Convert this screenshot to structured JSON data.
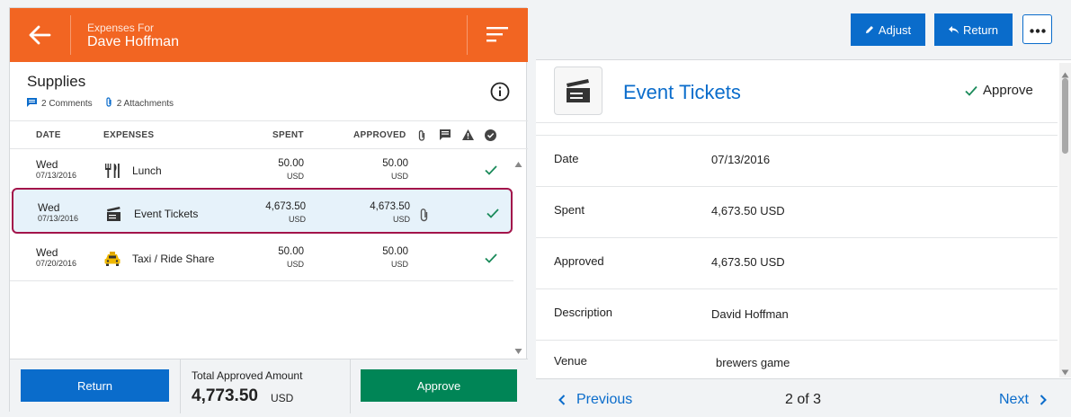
{
  "header": {
    "subtitle": "Expenses For",
    "employee": "Dave Hoffman"
  },
  "report": {
    "title": "Supplies",
    "comments": "2 Comments",
    "attachments": "2 Attachments"
  },
  "table": {
    "columns": {
      "date": "DATE",
      "expenses": "EXPENSES",
      "spent": "SPENT",
      "approved": "APPROVED"
    },
    "rows": [
      {
        "day": "Wed",
        "date": "07/13/2016",
        "icon": "fork-knife-icon",
        "label": "Lunch",
        "spent": "50.00",
        "spent_cur": "USD",
        "approved": "50.00",
        "approved_cur": "USD",
        "attachment": false
      },
      {
        "day": "Wed",
        "date": "07/13/2016",
        "icon": "clapperboard-icon",
        "label": "Event Tickets",
        "spent": "4,673.50",
        "spent_cur": "USD",
        "approved": "4,673.50",
        "approved_cur": "USD",
        "attachment": true,
        "selected": true
      },
      {
        "day": "Wed",
        "date": "07/20/2016",
        "icon": "taxi-icon",
        "label": "Taxi / Ride Share",
        "spent": "50.00",
        "spent_cur": "USD",
        "approved": "50.00",
        "approved_cur": "USD",
        "attachment": false
      }
    ]
  },
  "footer": {
    "return_label": "Return",
    "total_label": "Total Approved Amount",
    "total_value": "4,773.50",
    "total_currency": "USD",
    "approve_label": "Approve"
  },
  "toolbar": {
    "adjust_label": "Adjust",
    "return_label": "Return"
  },
  "detail": {
    "title": "Event Tickets",
    "approve_label": "Approve",
    "fields": [
      {
        "key": "Date",
        "value": "07/13/2016"
      },
      {
        "key": "Spent",
        "value": "4,673.50 USD"
      },
      {
        "key": "Approved",
        "value": "4,673.50 USD"
      },
      {
        "key": "Description",
        "value": "David Hoffman"
      },
      {
        "key": "Venue",
        "value": "brewers game"
      }
    ]
  },
  "pager": {
    "previous": "Previous",
    "position": "2 of 3",
    "next": "Next"
  },
  "colors": {
    "header_orange": "#f26522",
    "primary_blue": "#0a6ccb",
    "approve_green": "#008556",
    "selection_border": "#a3144a",
    "check_green": "#1a8a5a"
  }
}
